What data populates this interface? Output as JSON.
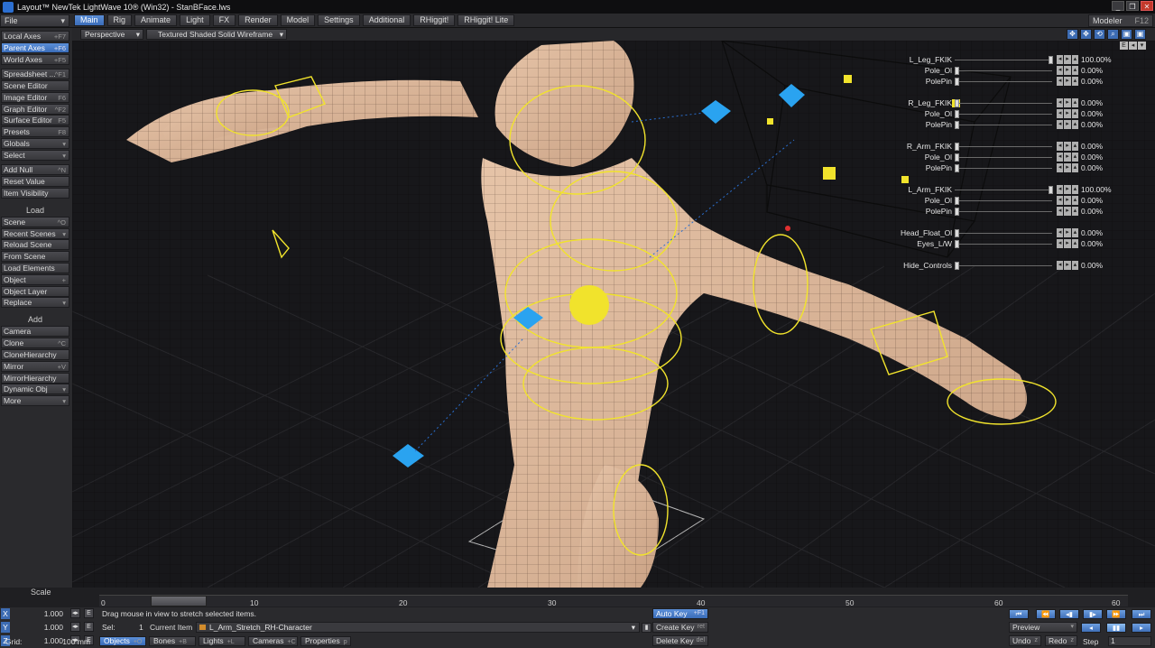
{
  "window": {
    "title": "Layout™ NewTek LightWave 10® (Win32) - StanBFace.lws"
  },
  "window_buttons": [
    "_",
    "❐",
    "✕"
  ],
  "file_menu": "File",
  "tabs": [
    {
      "label": "Main",
      "active": true
    },
    {
      "label": "Rig"
    },
    {
      "label": "Animate"
    },
    {
      "label": "Light"
    },
    {
      "label": "FX"
    },
    {
      "label": "Render"
    },
    {
      "label": "Model"
    },
    {
      "label": "Settings"
    },
    {
      "label": "Additional"
    },
    {
      "label": "RHiggit!"
    },
    {
      "label": "RHiggit! Lite"
    }
  ],
  "modeler": {
    "label": "Modeler",
    "shortcut": "F12"
  },
  "sidebar": {
    "items": [
      {
        "label": "Local Axes",
        "sc": "+F7"
      },
      {
        "label": "Parent Axes",
        "sc": "+F6",
        "sel": true
      },
      {
        "label": "World Axes",
        "sc": "+F5"
      },
      {
        "label": "Spreadsheet ...",
        "sc": "^F1"
      },
      {
        "label": "Scene Editor",
        "sc": ""
      },
      {
        "label": "Image Editor",
        "sc": "F6"
      },
      {
        "label": "Graph Editor",
        "sc": "^F2"
      },
      {
        "label": "Surface Editor",
        "sc": "F5"
      },
      {
        "label": "Presets",
        "sc": "F8"
      },
      {
        "label": "Globals",
        "sc": "▾"
      },
      {
        "label": "Select",
        "sc": "▾"
      },
      {
        "label": "Add Null",
        "sc": "^N"
      },
      {
        "label": "Reset Value",
        "sc": ""
      },
      {
        "label": "Item Visibility",
        "sc": ""
      },
      {
        "label": "Scene",
        "sc": "^O"
      },
      {
        "label": "Recent Scenes",
        "sc": "▾"
      },
      {
        "label": "Reload Scene",
        "sc": ""
      },
      {
        "label": "From Scene",
        "sc": ""
      },
      {
        "label": "Load Elements",
        "sc": ""
      },
      {
        "label": "Object",
        "sc": "+"
      },
      {
        "label": "Object Layer",
        "sc": ""
      },
      {
        "label": "Replace",
        "sc": "▾"
      },
      {
        "label": "Camera",
        "sc": ""
      },
      {
        "label": "Clone",
        "sc": "^C"
      },
      {
        "label": "CloneHierarchy",
        "sc": ""
      },
      {
        "label": "Mirror",
        "sc": "+V"
      },
      {
        "label": "MirrorHierarchy",
        "sc": ""
      },
      {
        "label": "Dynamic Obj",
        "sc": "▾"
      },
      {
        "label": "More",
        "sc": "▾"
      }
    ],
    "headings": {
      "load": "Load",
      "add": "Add"
    }
  },
  "viewport": {
    "view_mode": "Perspective",
    "shading_mode": "Textured Shaded Solid Wireframe",
    "tool_icons": [
      "✥",
      "✥",
      "⟲",
      "⌕",
      "▣",
      "▣"
    ]
  },
  "channels": [
    {
      "label": "L_Leg_FKIK",
      "value": "100.00%",
      "level": 1.0
    },
    {
      "label": "Pole_Ol",
      "value": "0.00%",
      "level": 0.0
    },
    {
      "label": "PolePin",
      "value": "0.00%",
      "level": 0.0
    },
    {
      "label": "R_Leg_FKIK",
      "value": "0.00%",
      "level": 0.0
    },
    {
      "label": "Pole_Ol",
      "value": "0.00%",
      "level": 0.0
    },
    {
      "label": "PolePin",
      "value": "0.00%",
      "level": 0.0
    },
    {
      "label": "R_Arm_FKIK",
      "value": "0.00%",
      "level": 0.0
    },
    {
      "label": "Pole_Ol",
      "value": "0.00%",
      "level": 0.0
    },
    {
      "label": "PolePin",
      "value": "0.00%",
      "level": 0.0
    },
    {
      "label": "L_Arm_FKIK",
      "value": "100.00%",
      "level": 1.0
    },
    {
      "label": "Pole_Ol",
      "value": "0.00%",
      "level": 0.0
    },
    {
      "label": "PolePin",
      "value": "0.00%",
      "level": 0.0
    },
    {
      "label": "Head_Float_Ol",
      "value": "0.00%",
      "level": 0.0
    },
    {
      "label": "Eyes_L/W",
      "value": "0.00%",
      "level": 0.0
    },
    {
      "label": "Hide_Controls",
      "value": "0.00%",
      "level": 0.0
    }
  ],
  "timeline": {
    "scale_label": "Scale",
    "ticks": [
      "0",
      "10",
      "20",
      "30",
      "40",
      "50",
      "60"
    ],
    "current_frame": "0",
    "end_frame": "60"
  },
  "axes": [
    {
      "axis": "X",
      "value": "1.000"
    },
    {
      "axis": "Y",
      "value": "1.000"
    },
    {
      "axis": "Z",
      "value": "1.000"
    }
  ],
  "status": {
    "message": "Drag mouse in view to stretch selected items.",
    "sel_label": "Sel:",
    "sel_count": "1",
    "current_item_label": "Current Item",
    "current_item": "L_Arm_Stretch_RH-Character",
    "grid_label": "Grid:",
    "grid_value": "100 mm"
  },
  "selection_buttons": [
    {
      "label": "Objects",
      "sc": "+O",
      "on": true
    },
    {
      "label": "Bones",
      "sc": "+B"
    },
    {
      "label": "Lights",
      "sc": "+L"
    },
    {
      "label": "Cameras",
      "sc": "+C"
    },
    {
      "label": "Properties",
      "sc": "p"
    }
  ],
  "key_buttons": {
    "auto_key": "Auto Key",
    "auto_key_sc": "+F1",
    "create_key": "Create Key",
    "create_key_sc": "ret",
    "delete_key": "Delete Key",
    "delete_key_sc": "del"
  },
  "playback": {
    "preview": "Preview",
    "undo": "Undo",
    "undo_sc": "z",
    "redo": "Redo",
    "redo_sc": "z",
    "step_label": "Step",
    "step_value": "1"
  },
  "colors": {
    "accent": "#3d6cb3",
    "skin": "#d9b59a",
    "rig_yellow": "#f1e32c",
    "control_blue": "#2aa3f0"
  }
}
